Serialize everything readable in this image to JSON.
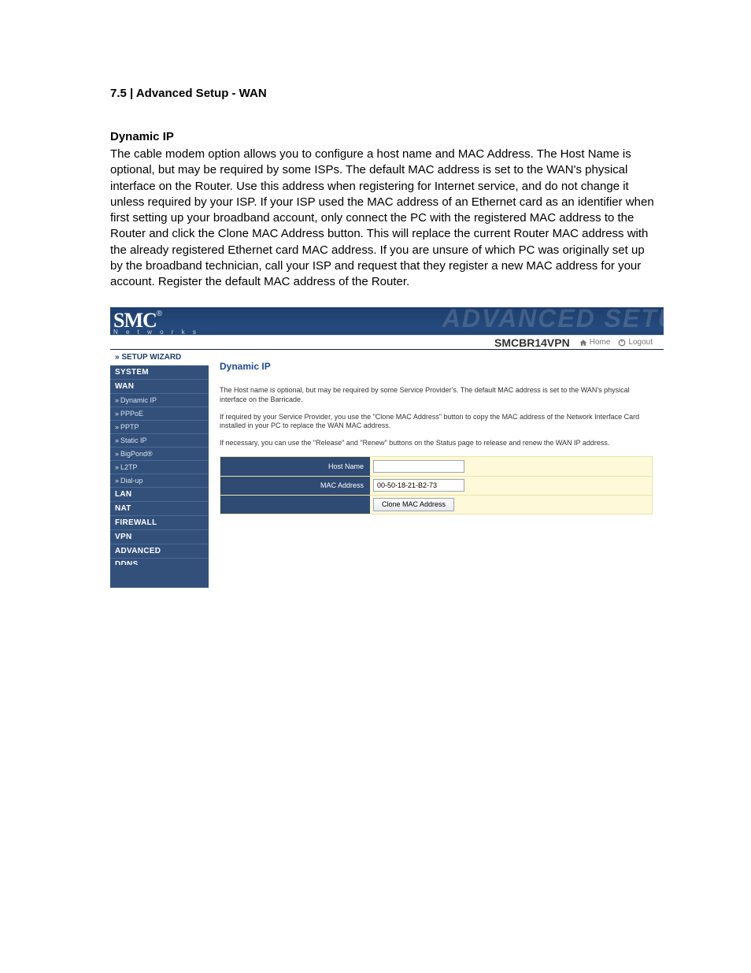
{
  "doc": {
    "section_title": "7.5 | Advanced Setup - WAN",
    "subtitle": "Dynamic IP",
    "body": "The cable modem option allows you to configure a host name and MAC Address. The Host Name is optional, but may be required by some ISPs. The default MAC address is set to the WAN's physical interface on the Router. Use this address when registering for Internet service, and do not change it unless required by your ISP. If your ISP used the MAC address of an Ethernet card as an identifier when first setting up your broadband account, only connect the PC with the registered MAC address to the Router and click the Clone MAC Address button. This will replace the current Router MAC address with the already registered Ethernet card MAC address. If you are unsure of which PC was originally set up by the broadband technician, call your ISP and request that they register a new MAC address for your account. Register the default MAC address of the Router."
  },
  "header": {
    "logo_main": "SMC",
    "logo_reg": "®",
    "logo_sub": "N e t w o r k s",
    "ghost": "ADVANCED SETU",
    "model": "SMCBR14VPN",
    "home_label": "Home",
    "logout_label": "Logout"
  },
  "sidebar": {
    "setup_wizard": "» SETUP WIZARD",
    "items": [
      {
        "label": "SYSTEM",
        "type": "main"
      },
      {
        "label": "WAN",
        "type": "main"
      },
      {
        "label": "Dynamic IP",
        "type": "sub"
      },
      {
        "label": "PPPoE",
        "type": "sub"
      },
      {
        "label": "PPTP",
        "type": "sub"
      },
      {
        "label": "Static IP",
        "type": "sub"
      },
      {
        "label": "BigPond®",
        "type": "sub"
      },
      {
        "label": "L2TP",
        "type": "sub"
      },
      {
        "label": "Dial-up",
        "type": "sub"
      },
      {
        "label": "LAN",
        "type": "main"
      },
      {
        "label": "NAT",
        "type": "main"
      },
      {
        "label": "FIREWALL",
        "type": "main"
      },
      {
        "label": "VPN",
        "type": "main"
      },
      {
        "label": "ADVANCED",
        "type": "main"
      },
      {
        "label": "DDNS",
        "type": "main"
      }
    ]
  },
  "content": {
    "title": "Dynamic IP",
    "para1": "The Host name is optional, but may be required by some Service Provider's. The default MAC address is set to the WAN's physical interface on the Barricade.",
    "para2": "If required by your Service Provider, you use the \"Clone MAC Address\" button to copy the MAC address of the Network Interface Card installed in your PC to replace the WAN MAC address.",
    "para3": "If necessary, you can use the \"Release\" and \"Renew\" buttons on the Status page to release and renew the WAN IP address.",
    "form": {
      "host_name_label": "Host Name",
      "host_name_value": "",
      "mac_label": "MAC Address",
      "mac_value": "00-50-18-21-B2-73",
      "clone_button": "Clone MAC Address"
    }
  }
}
